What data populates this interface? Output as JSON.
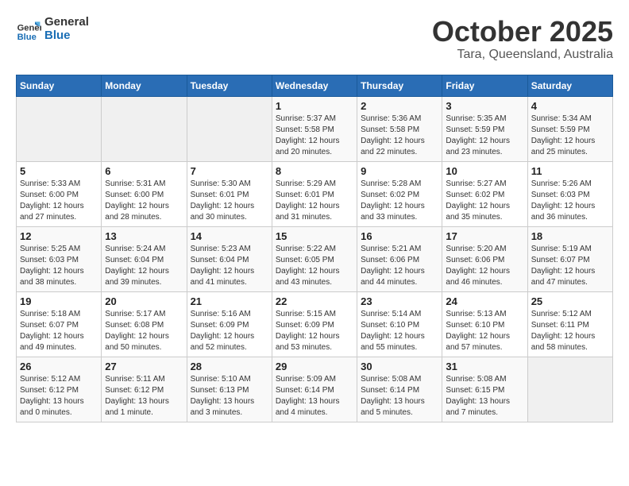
{
  "header": {
    "logo_line1": "General",
    "logo_line2": "Blue",
    "month": "October 2025",
    "location": "Tara, Queensland, Australia"
  },
  "days_of_week": [
    "Sunday",
    "Monday",
    "Tuesday",
    "Wednesday",
    "Thursday",
    "Friday",
    "Saturday"
  ],
  "weeks": [
    [
      {
        "day": "",
        "info": ""
      },
      {
        "day": "",
        "info": ""
      },
      {
        "day": "",
        "info": ""
      },
      {
        "day": "1",
        "info": "Sunrise: 5:37 AM\nSunset: 5:58 PM\nDaylight: 12 hours\nand 20 minutes."
      },
      {
        "day": "2",
        "info": "Sunrise: 5:36 AM\nSunset: 5:58 PM\nDaylight: 12 hours\nand 22 minutes."
      },
      {
        "day": "3",
        "info": "Sunrise: 5:35 AM\nSunset: 5:59 PM\nDaylight: 12 hours\nand 23 minutes."
      },
      {
        "day": "4",
        "info": "Sunrise: 5:34 AM\nSunset: 5:59 PM\nDaylight: 12 hours\nand 25 minutes."
      }
    ],
    [
      {
        "day": "5",
        "info": "Sunrise: 5:33 AM\nSunset: 6:00 PM\nDaylight: 12 hours\nand 27 minutes."
      },
      {
        "day": "6",
        "info": "Sunrise: 5:31 AM\nSunset: 6:00 PM\nDaylight: 12 hours\nand 28 minutes."
      },
      {
        "day": "7",
        "info": "Sunrise: 5:30 AM\nSunset: 6:01 PM\nDaylight: 12 hours\nand 30 minutes."
      },
      {
        "day": "8",
        "info": "Sunrise: 5:29 AM\nSunset: 6:01 PM\nDaylight: 12 hours\nand 31 minutes."
      },
      {
        "day": "9",
        "info": "Sunrise: 5:28 AM\nSunset: 6:02 PM\nDaylight: 12 hours\nand 33 minutes."
      },
      {
        "day": "10",
        "info": "Sunrise: 5:27 AM\nSunset: 6:02 PM\nDaylight: 12 hours\nand 35 minutes."
      },
      {
        "day": "11",
        "info": "Sunrise: 5:26 AM\nSunset: 6:03 PM\nDaylight: 12 hours\nand 36 minutes."
      }
    ],
    [
      {
        "day": "12",
        "info": "Sunrise: 5:25 AM\nSunset: 6:03 PM\nDaylight: 12 hours\nand 38 minutes."
      },
      {
        "day": "13",
        "info": "Sunrise: 5:24 AM\nSunset: 6:04 PM\nDaylight: 12 hours\nand 39 minutes."
      },
      {
        "day": "14",
        "info": "Sunrise: 5:23 AM\nSunset: 6:04 PM\nDaylight: 12 hours\nand 41 minutes."
      },
      {
        "day": "15",
        "info": "Sunrise: 5:22 AM\nSunset: 6:05 PM\nDaylight: 12 hours\nand 43 minutes."
      },
      {
        "day": "16",
        "info": "Sunrise: 5:21 AM\nSunset: 6:06 PM\nDaylight: 12 hours\nand 44 minutes."
      },
      {
        "day": "17",
        "info": "Sunrise: 5:20 AM\nSunset: 6:06 PM\nDaylight: 12 hours\nand 46 minutes."
      },
      {
        "day": "18",
        "info": "Sunrise: 5:19 AM\nSunset: 6:07 PM\nDaylight: 12 hours\nand 47 minutes."
      }
    ],
    [
      {
        "day": "19",
        "info": "Sunrise: 5:18 AM\nSunset: 6:07 PM\nDaylight: 12 hours\nand 49 minutes."
      },
      {
        "day": "20",
        "info": "Sunrise: 5:17 AM\nSunset: 6:08 PM\nDaylight: 12 hours\nand 50 minutes."
      },
      {
        "day": "21",
        "info": "Sunrise: 5:16 AM\nSunset: 6:09 PM\nDaylight: 12 hours\nand 52 minutes."
      },
      {
        "day": "22",
        "info": "Sunrise: 5:15 AM\nSunset: 6:09 PM\nDaylight: 12 hours\nand 53 minutes."
      },
      {
        "day": "23",
        "info": "Sunrise: 5:14 AM\nSunset: 6:10 PM\nDaylight: 12 hours\nand 55 minutes."
      },
      {
        "day": "24",
        "info": "Sunrise: 5:13 AM\nSunset: 6:10 PM\nDaylight: 12 hours\nand 57 minutes."
      },
      {
        "day": "25",
        "info": "Sunrise: 5:12 AM\nSunset: 6:11 PM\nDaylight: 12 hours\nand 58 minutes."
      }
    ],
    [
      {
        "day": "26",
        "info": "Sunrise: 5:12 AM\nSunset: 6:12 PM\nDaylight: 13 hours\nand 0 minutes."
      },
      {
        "day": "27",
        "info": "Sunrise: 5:11 AM\nSunset: 6:12 PM\nDaylight: 13 hours\nand 1 minute."
      },
      {
        "day": "28",
        "info": "Sunrise: 5:10 AM\nSunset: 6:13 PM\nDaylight: 13 hours\nand 3 minutes."
      },
      {
        "day": "29",
        "info": "Sunrise: 5:09 AM\nSunset: 6:14 PM\nDaylight: 13 hours\nand 4 minutes."
      },
      {
        "day": "30",
        "info": "Sunrise: 5:08 AM\nSunset: 6:14 PM\nDaylight: 13 hours\nand 5 minutes."
      },
      {
        "day": "31",
        "info": "Sunrise: 5:08 AM\nSunset: 6:15 PM\nDaylight: 13 hours\nand 7 minutes."
      },
      {
        "day": "",
        "info": ""
      }
    ]
  ]
}
